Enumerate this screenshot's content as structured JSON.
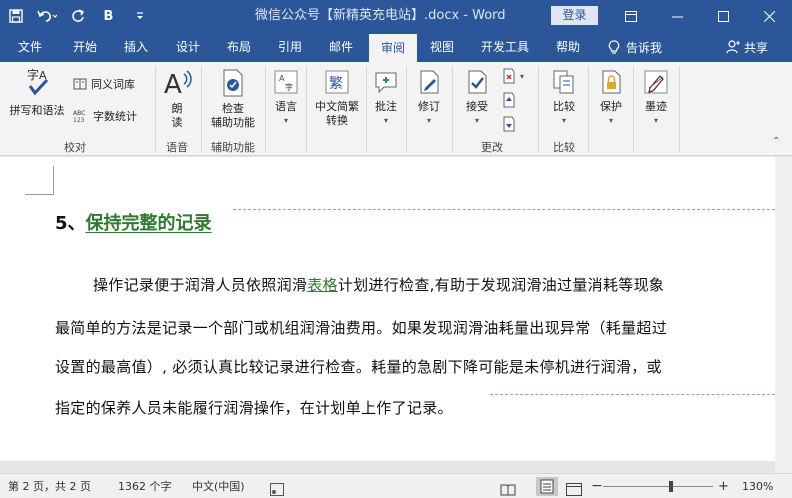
{
  "titlebar": {
    "doc_title": "微信公众号【新精英充电站】.docx  -  Word",
    "login_label": "登录",
    "qat": {
      "bold_label": "B"
    }
  },
  "tabs": [
    "文件",
    "开始",
    "插入",
    "设计",
    "布局",
    "引用",
    "邮件",
    "审阅",
    "视图",
    "开发工具",
    "帮助"
  ],
  "active_tab": "审阅",
  "tell_me": "告诉我",
  "share": "共享",
  "ribbon": {
    "proofing": {
      "spell_label": "拼写和语法",
      "thesaurus_label": "同义词库",
      "wordcount_label": "字数统计",
      "group_label": "校对"
    },
    "speech": {
      "read_label_1": "朗",
      "read_label_2": "读",
      "group_label": "语音"
    },
    "accessibility": {
      "check_label_1": "检查",
      "check_label_2": "辅助功能",
      "group_label": "辅助功能"
    },
    "language": {
      "label": "语言"
    },
    "chinese": {
      "label_1": "中文简繁",
      "label_2": "转换"
    },
    "comments": {
      "label": "批注"
    },
    "tracking": {
      "label": "修订"
    },
    "changes": {
      "accept_label": "接受",
      "group_label": "更改"
    },
    "compare": {
      "label": "比较",
      "group_label": "比较"
    },
    "protect": {
      "label": "保护"
    },
    "ink": {
      "label": "墨迹"
    }
  },
  "document": {
    "heading_num": "5、",
    "heading_text": "保持完整的记录",
    "line1_before": "操作记录便于润滑人员依照润滑",
    "line1_link": "表格",
    "line1_after": "计划进行检查,有助于发现润滑油过量消耗等现象",
    "line2": "最简单的方法是记录一个部门或机组润滑油费用。如果发现润滑油耗量出现异常（耗量超过",
    "line3": "设置的最高值）, 必须认真比较记录进行检查。耗量的急剧下降可能是未停机进行润滑，或",
    "line4": "指定的保养人员未能履行润滑操作，在计划单上作了记录。"
  },
  "statusbar": {
    "page": "第 2 页，共 2 页",
    "words": "1362 个字",
    "lang": "中文(中国)",
    "zoom": "130%",
    "zoom_minus": "−",
    "zoom_plus": "+"
  },
  "colors": {
    "accent": "#2b579a",
    "heading_green": "#2f7a2f"
  }
}
